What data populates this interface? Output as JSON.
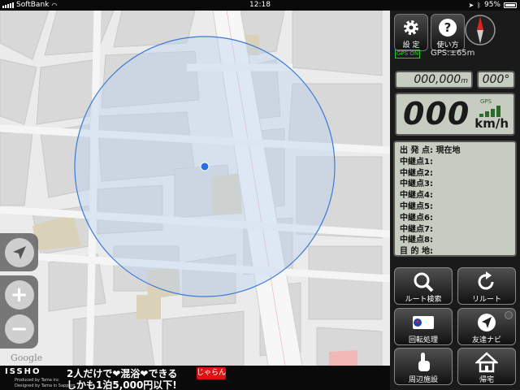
{
  "status_bar": {
    "carrier": "SoftBank",
    "time": "12:18",
    "battery": "95%"
  },
  "map": {
    "attribution": "Google",
    "circle_color": "#3b7bd6"
  },
  "map_controls": {
    "locate_icon": "location-arrow-icon",
    "zoom_in_label": "+",
    "zoom_out_label": "−"
  },
  "ad": {
    "brand": "ISSHO",
    "brand_sub1": "Produced by Tama inc",
    "brand_sub2": "Designed by Tama in Sapporo",
    "line1": "2人だけで❤混浴❤できる",
    "line2": "しかも1泊5,000円以下!",
    "badge": "じゃらん"
  },
  "panel": {
    "settings_label": "設 定",
    "help_label": "使い方",
    "gps_badge": "GPS ON",
    "gps_accuracy": "GPS:±65m",
    "distance": "000,000",
    "distance_unit": "m",
    "direction": "000°",
    "speed": "000",
    "speed_unit": "km/h",
    "speed_gps": "GPS",
    "route": [
      "出 発 点: 現在地",
      "中継点1:",
      "中継点2:",
      "中継点3:",
      "中継点4:",
      "中継点5:",
      "中継点6:",
      "中継点7:",
      "中継点8:",
      "目 的 地:"
    ],
    "buttons": {
      "route_search": "ルート検索",
      "reroute": "リルート",
      "rotate": "回転処理",
      "friend_navi": "友達ナビ",
      "nearby": "周辺施設",
      "home": "帰宅",
      "compass_ready": "Compass Ready"
    }
  },
  "colors": {
    "accent_green": "#22cc22",
    "lcd_bg": "#c7ccc0",
    "heart": "#e02020"
  }
}
